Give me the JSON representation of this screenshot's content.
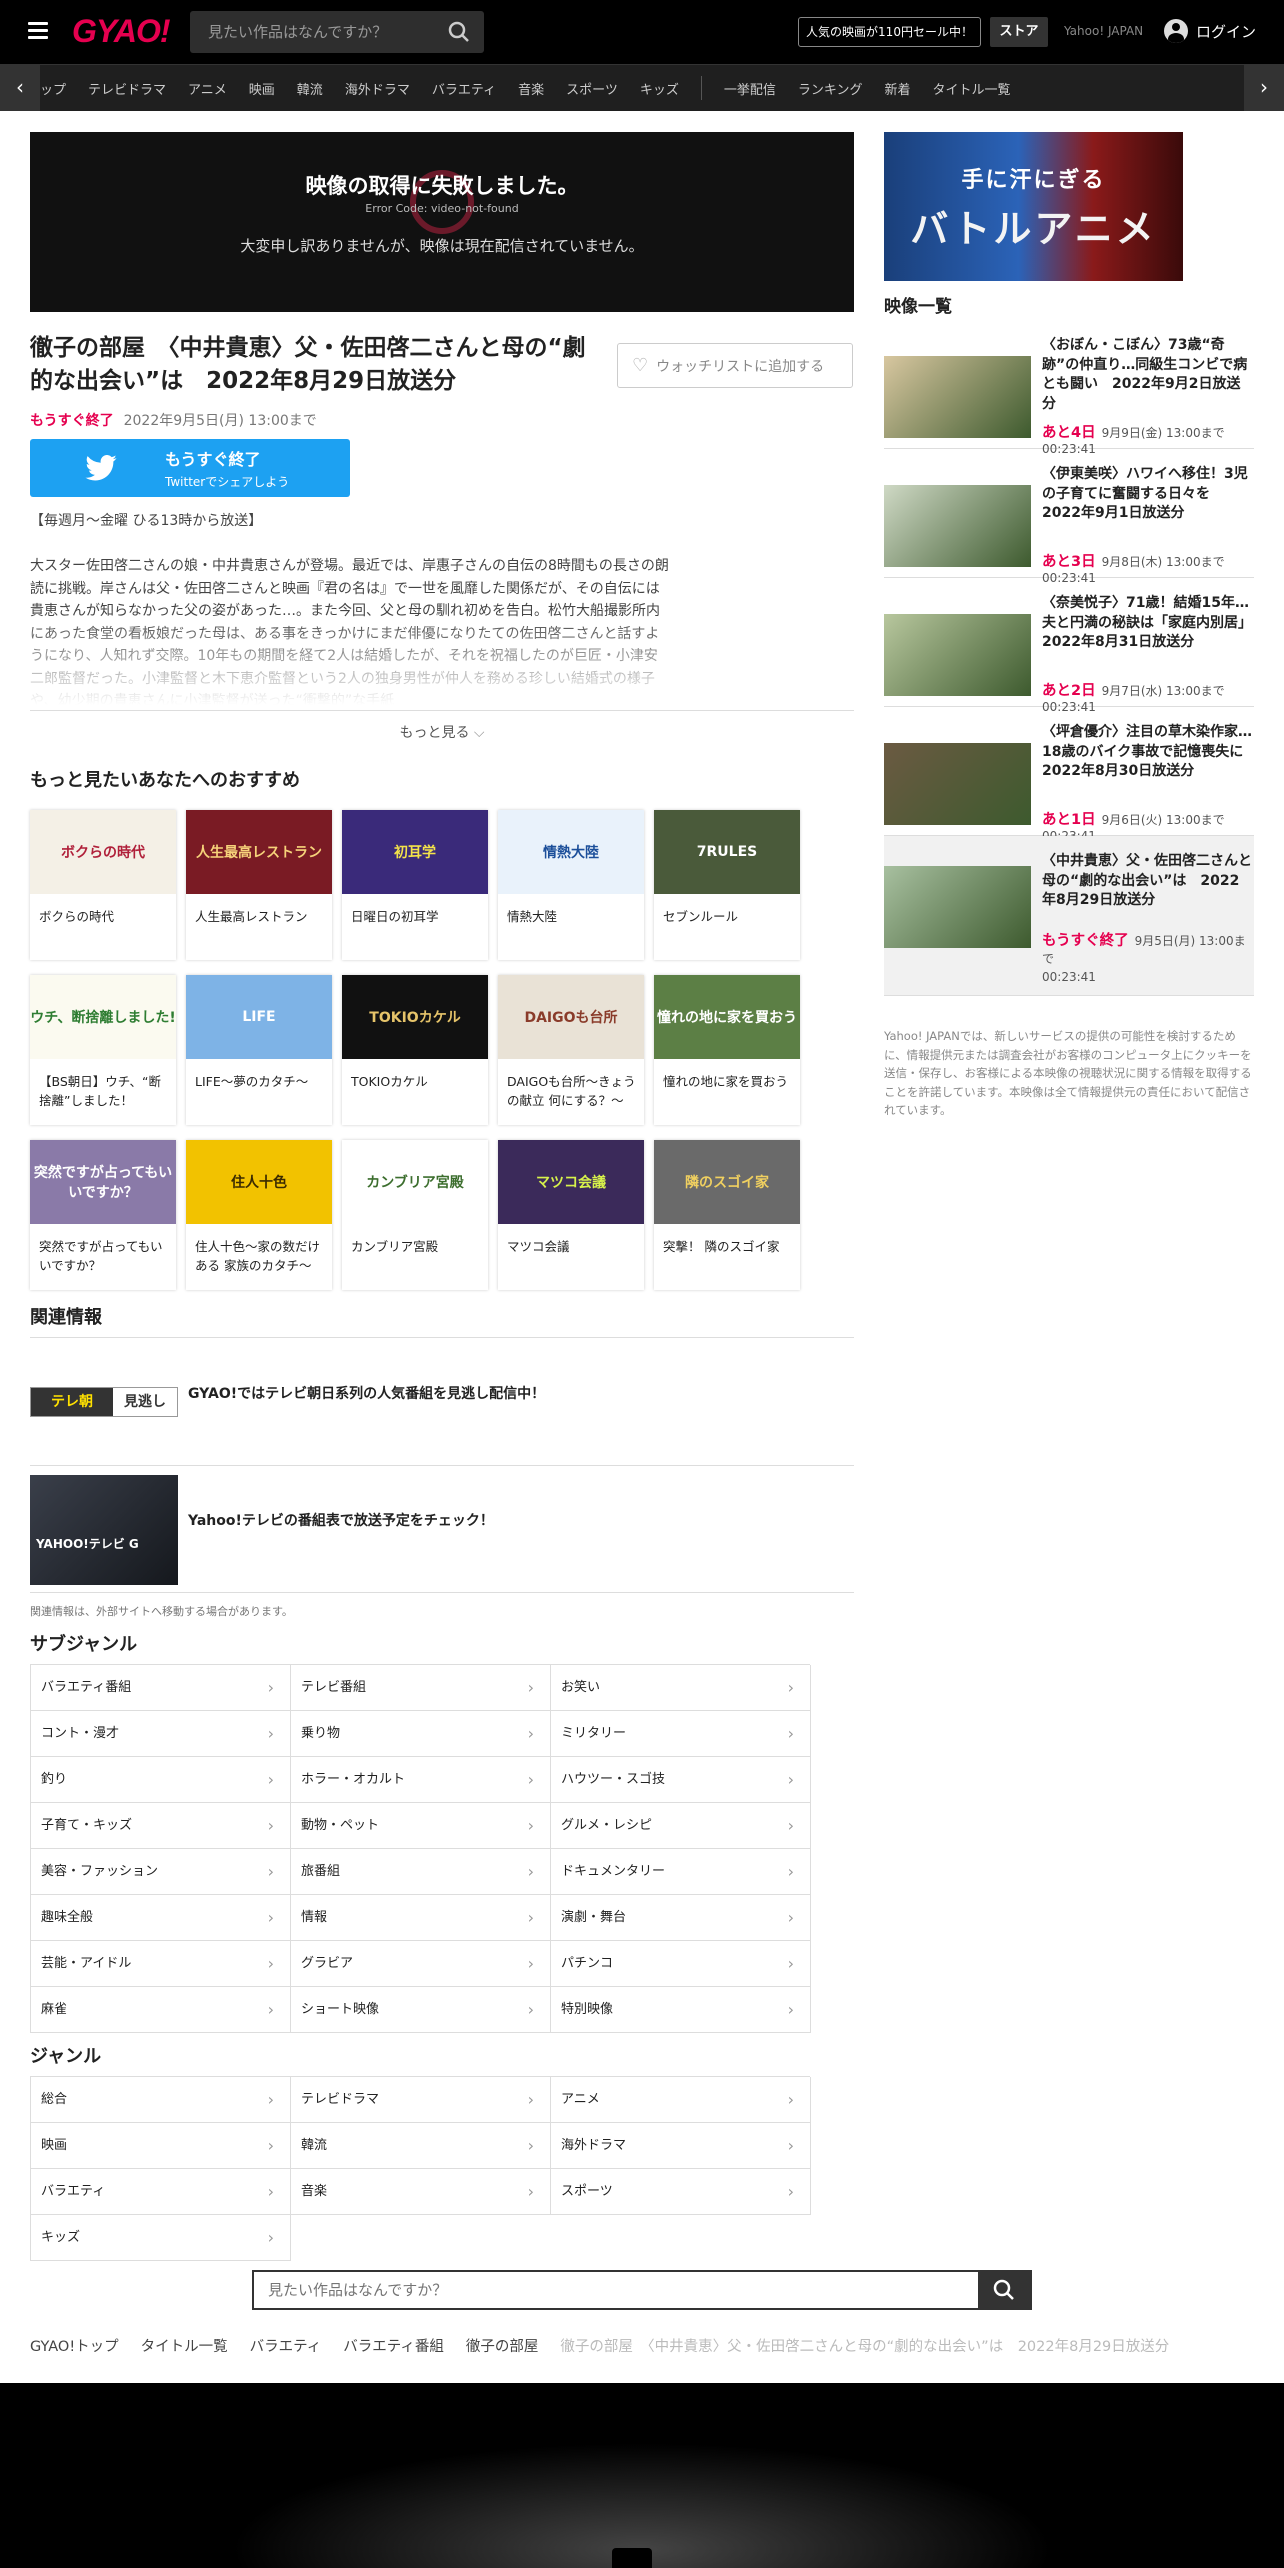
{
  "header": {
    "logo": "GYAO!",
    "search_placeholder": "見たい作品はなんですか？",
    "sale": "人気の映画が110円セール中！",
    "store": "ストア",
    "yahoo": "Yahoo! JAPAN",
    "login": "ログイン"
  },
  "nav": {
    "items": [
      "ップ",
      "テレビドラマ",
      "アニメ",
      "映画",
      "韓流",
      "海外ドラマ",
      "バラエティ",
      "音楽",
      "スポーツ",
      "キッズ"
    ],
    "items2": [
      "一挙配信",
      "ランキング",
      "新着",
      "タイトル一覧"
    ],
    "prev": "‹",
    "next": "›"
  },
  "player": {
    "error": "映像の取得に失敗しました。",
    "code": "Error Code: video-not-found",
    "message": "大変申し訳ありませんが、映像は現在配信されていません。"
  },
  "ad": {
    "line1": "手に汗にぎる",
    "line2": "バトルアニメ"
  },
  "episode": {
    "title": "徹子の部屋　〈中井貴恵〉父・佐田啓二さんと母の“劇的な出会い”は　2022年8月29日放送分",
    "watchlist": "ウォッチリストに追加する",
    "status": "もうすぐ終了",
    "until": "2022年9月5日(月) 13:00まで",
    "share_line1": "もうすぐ終了",
    "share_line2": "Twitterでシェアしよう",
    "schedule": "【毎週月～金曜 ひる13時から放送】",
    "description": "大スター佐田啓二さんの娘・中井貴恵さんが登場。最近では、岸惠子さんの自伝の8時間もの長さの朗読に挑戦。岸さんは父・佐田啓二さんと映画『君の名は』で一世を風靡した関係だが、その自伝には貴恵さんが知らなかった父の姿があった…。また今回、父と母の馴れ初めを告白。松竹大船撮影所内にあった食堂の看板娘だった母は、ある事をきっかけにまだ俳優になりたての佐田啓二さんと話すようになり、人知れず交際。10年もの期間を経て2人は結婚したが、それを祝福したのが巨匠・小津安二郎監督だった。小津監督と木下恵介監督という2人の独身男性が仲人を務める珍しい結婚式の様子や、幼少期の貴恵さんに小津監督が送った“衝撃的”な手紙",
    "more": "もっと見る"
  },
  "recommend": {
    "heading": "もっと見たいあなたへのおすすめ",
    "items": [
      {
        "label": "ボクらの時代",
        "thumb": "ボクらの時代",
        "color": "#f4f0e6",
        "fg": "#b0203a"
      },
      {
        "label": "人生最高レストラン",
        "thumb": "人生最高レストラン",
        "color": "#7a1b24",
        "fg": "#f6d27a"
      },
      {
        "label": "日曜日の初耳学",
        "thumb": "初耳学",
        "color": "#3a2a7a",
        "fg": "#f4e34a"
      },
      {
        "label": "情熱大陸",
        "thumb": "情熱大陸",
        "color": "#e9f2fb",
        "fg": "#1c4f9a"
      },
      {
        "label": "セブンルール",
        "thumb": "7RULES",
        "color": "#4a5a3a",
        "fg": "#ffffff"
      },
      {
        "label": "【BS朝日】ウチ、“断捨離”しました！",
        "thumb": "ウチ、断捨離しました!",
        "color": "#fbfaf0",
        "fg": "#2e7d32"
      },
      {
        "label": "LIFE～夢のカタチ～",
        "thumb": "LIFE",
        "color": "#7eb3e6",
        "fg": "#ffffff"
      },
      {
        "label": "TOKIOカケル",
        "thumb": "TOKIOカケル",
        "color": "#111111",
        "fg": "#e6c46a"
      },
      {
        "label": "DAIGOも台所～きょうの献立 何にする？～",
        "thumb": "DAIGOも台所",
        "color": "#e9e2d6",
        "fg": "#8a3b2a"
      },
      {
        "label": "憧れの地に家を買おう",
        "thumb": "憧れの地に家を買おう",
        "color": "#5c7f45",
        "fg": "#ffffff"
      },
      {
        "label": "突然ですが占ってもいいですか？",
        "thumb": "突然ですが占ってもいいですか？",
        "color": "#8a7aa8",
        "fg": "#ffffff"
      },
      {
        "label": "住人十色～家の数だけある 家族のカタチ～",
        "thumb": "住人十色",
        "color": "#f2c200",
        "fg": "#3a2a00"
      },
      {
        "label": "カンブリア宮殿",
        "thumb": "カンブリア宮殿",
        "color": "#ffffff",
        "fg": "#3c6e2e"
      },
      {
        "label": "マツコ会議",
        "thumb": "マツコ会議",
        "color": "#3b2a5a",
        "fg": "#d7f24b"
      },
      {
        "label": "突撃！ 隣のスゴイ家",
        "thumb": "隣のスゴイ家",
        "color": "#6a6a6a",
        "fg": "#f0d060"
      }
    ]
  },
  "related": {
    "heading": "関連情報",
    "items": [
      {
        "text": "GYAO!ではテレビ朝日系列の人気番組を見逃し配信中！",
        "badge": "テレ朝",
        "badge2": "見逃し"
      },
      {
        "text": "Yahoo!テレビの番組表で放送予定をチェック！",
        "badge": "YAHOO!テレビ G"
      }
    ],
    "note": "関連情報は、外部サイトへ移動する場合があります。"
  },
  "subgenre": {
    "heading": "サブジャンル",
    "items": [
      "バラエティ番組",
      "テレビ番組",
      "お笑い",
      "コント・漫才",
      "乗り物",
      "ミリタリー",
      "釣り",
      "ホラー・オカルト",
      "ハウツー・スゴ技",
      "子育て・キッズ",
      "動物・ペット",
      "グルメ・レシピ",
      "美容・ファッション",
      "旅番組",
      "ドキュメンタリー",
      "趣味全般",
      "情報",
      "演劇・舞台",
      "芸能・アイドル",
      "グラビア",
      "パチンコ",
      "麻雀",
      "ショート映像",
      "特別映像"
    ]
  },
  "genre": {
    "heading": "ジャンル",
    "items": [
      "総合",
      "テレビドラマ",
      "アニメ",
      "映画",
      "韓流",
      "海外ドラマ",
      "バラエティ",
      "音楽",
      "スポーツ",
      "キッズ"
    ]
  },
  "bottom_search": {
    "placeholder": "見たい作品はなんですか？"
  },
  "breadcrumb": [
    "GYAO!トップ",
    "タイトル一覧",
    "バラエティ",
    "バラエティ番組",
    "徹子の部屋"
  ],
  "breadcrumb_current": "徹子の部屋　〈中井貴恵〉父・佐田啓二さんと母の“劇的な出会い”は　2022年8月29日放送分",
  "video_list": {
    "heading": "映像一覧",
    "items": [
      {
        "title": "〈おぼん・こぼん〉73歳“奇跡”の仲直り…同級生コンビで病とも闘い　2022年9月2日放送分",
        "remain": "あと4日",
        "until": "9月9日(金) 13:00まで",
        "duration": "00:23:41",
        "active": false
      },
      {
        "title": "〈伊東美咲〉ハワイへ移住！3児の子育てに奮闘する日々を　2022年9月1日放送分",
        "remain": "あと3日",
        "until": "9月8日(木) 13:00まで",
        "duration": "00:23:41",
        "active": false
      },
      {
        "title": "〈奈美悦子〉71歳！結婚15年…夫と円満の秘訣は「家庭内別居」　2022年8月31日放送分",
        "remain": "あと2日",
        "until": "9月7日(水) 13:00まで",
        "duration": "00:23:41",
        "active": false
      },
      {
        "title": "〈坪倉優介〉注目の草木染作家…18歳のバイク事故で記憶喪失に　2022年8月30日放送分",
        "remain": "あと1日",
        "until": "9月6日(火) 13:00まで",
        "duration": "00:23:41",
        "active": false
      },
      {
        "title": "〈中井貴恵〉父・佐田啓二さんと母の“劇的な出会い”は　2022年8月29日放送分",
        "remain": "もうすぐ終了",
        "until": "9月5日(月) 13:00まで",
        "duration": "00:23:41",
        "active": true
      }
    ]
  },
  "notice": "Yahoo! JAPANでは、新しいサービスの提供の可能性を検討するために、情報提供元または調査会社がお客様のコンピュータ上にクッキーを送信・保存し、お客様による本映像の視聴状況に関する情報を取得することを許諾しています。本映像は全て情報提供元の責任において配信されています。"
}
